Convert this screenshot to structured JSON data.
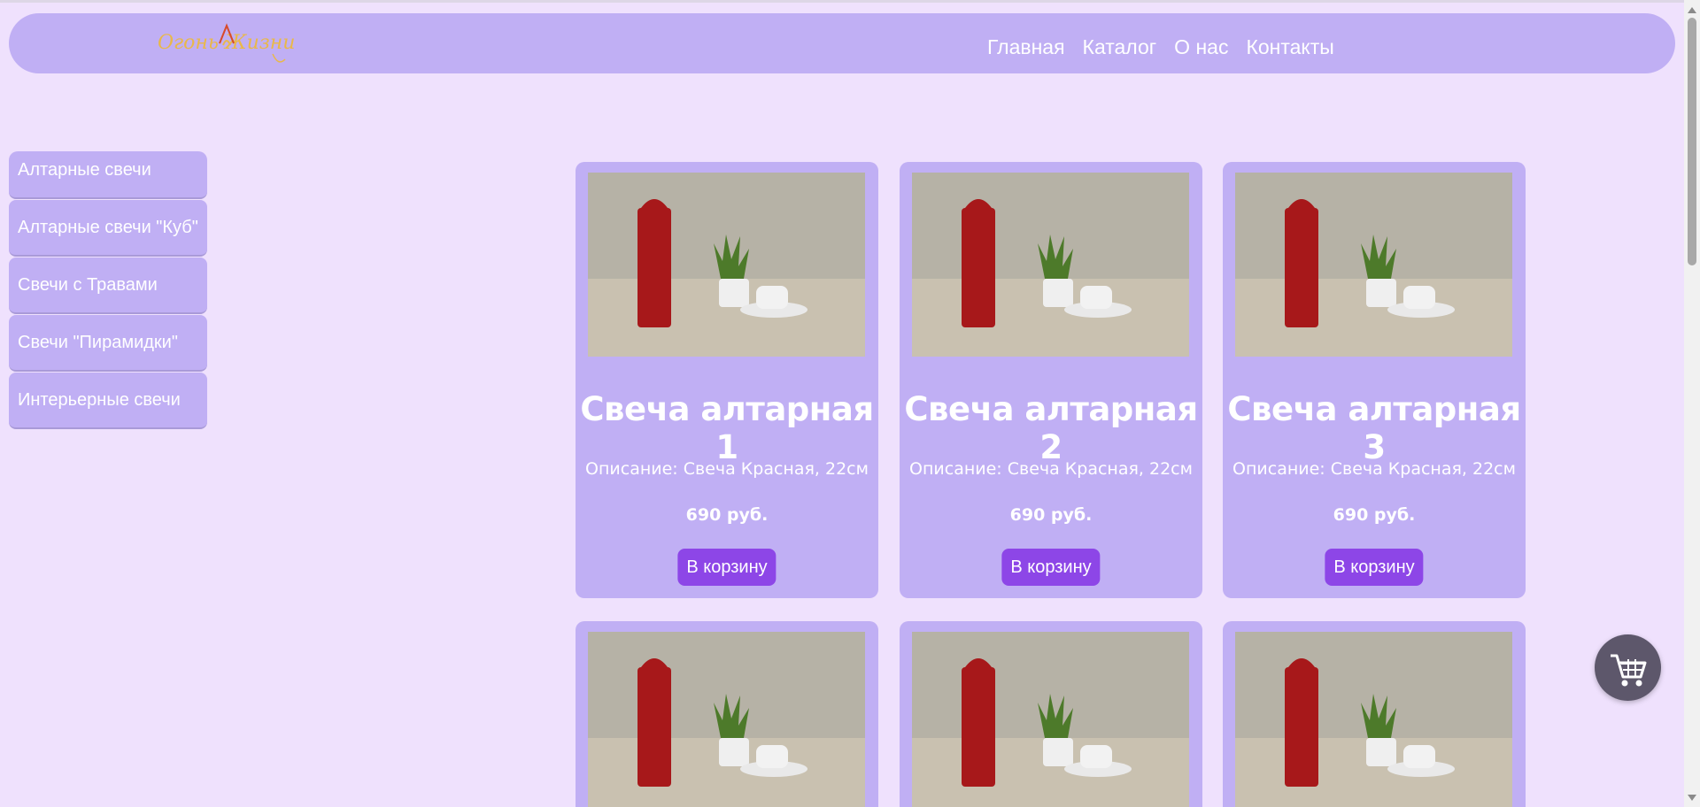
{
  "header": {
    "logo_text": "Огонь Жизни",
    "nav": [
      "Главная",
      "Каталог",
      "О нас",
      "Контакты"
    ]
  },
  "sidebar": {
    "items": [
      {
        "label": "Алтарные свечи"
      },
      {
        "label": "Алтарные свечи \"Куб\""
      },
      {
        "label": "Свечи с Травами"
      },
      {
        "label": "Свечи \"Пирамидки\""
      },
      {
        "label": "Интерьерные свечи"
      }
    ]
  },
  "products": [
    {
      "title": "Свеча алтарная 1",
      "description": "Описание: Свеча Красная, 22см",
      "price": "690 руб.",
      "button": "В корзину"
    },
    {
      "title": "Свеча алтарная 2",
      "description": "Описание: Свеча Красная, 22см",
      "price": "690 руб.",
      "button": "В корзину"
    },
    {
      "title": "Свеча алтарная 3",
      "description": "Описание: Свеча Красная, 22см",
      "price": "690 руб.",
      "button": "В корзину"
    }
  ],
  "cart": {
    "icon": "cart-icon"
  },
  "colors": {
    "page_bg": "#efe1fd",
    "panel": "#c0aff4",
    "button": "#8d46e7",
    "cart_fab": "#5d576b",
    "logo": "#e9b84a"
  }
}
